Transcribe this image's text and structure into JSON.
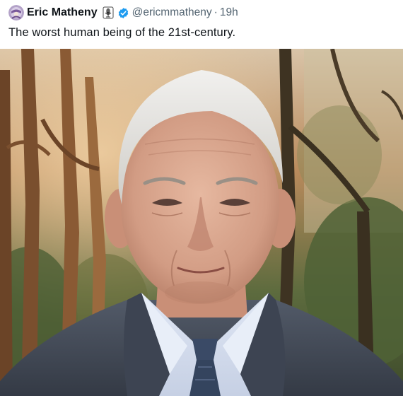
{
  "tweet": {
    "author_name": "Eric Matheny",
    "handle": "@ericmmatheny",
    "separator": "·",
    "timestamp": "19h",
    "text": "The worst human being of the 21st-century."
  },
  "icons": {
    "avatar": "avatar",
    "affiliate_badge": "microphone-icon",
    "verified_badge": "verified-badge-icon"
  },
  "colors": {
    "verified": "#1d9bf0",
    "secondary_text": "#536471",
    "primary_text": "#0f1419"
  }
}
